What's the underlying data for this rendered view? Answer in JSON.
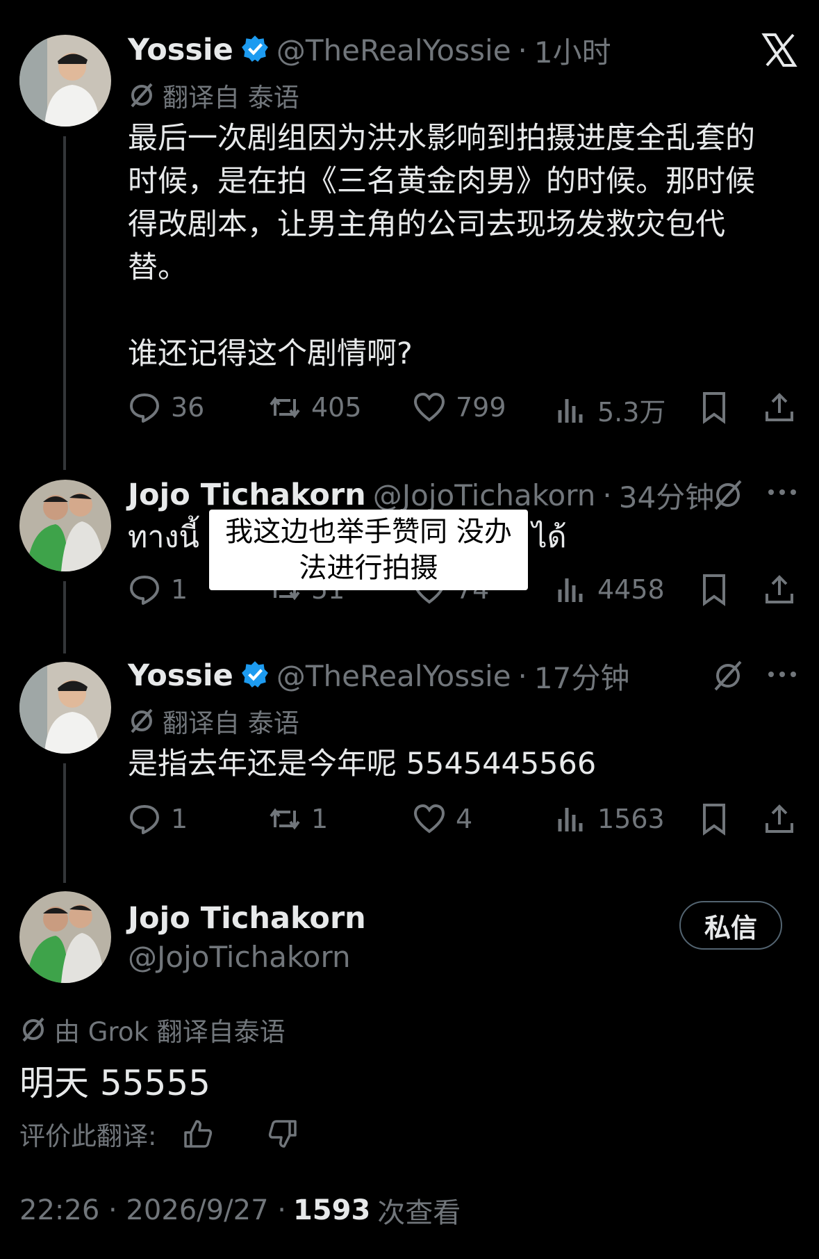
{
  "tweet1": {
    "name": "Yossie",
    "handle": "@TheRealYossie",
    "time": "1小时",
    "translated_label": "翻译自 泰语",
    "text_lines": [
      "最后一次剧组因为洪水影响到拍摄进度全乱套的",
      "时候，是在拍《三名黄金肉男》的时候。那时候",
      "得改剧本，让男主角的公司去现场发救灾包代",
      "替。"
    ],
    "text_line2": "谁还记得这个剧情啊?",
    "replies": "36",
    "reposts": "405",
    "likes": "799",
    "views": "5.3万"
  },
  "tweet2": {
    "name": "Jojo Tichakorn",
    "handle": "@JojoTichakorn",
    "time": "34分钟",
    "text_left": "ทางนี้",
    "text_right": "ได้",
    "overlay_line1": "我这边也举手赞同  没办",
    "overlay_line2": "法进行拍摄",
    "replies": "1",
    "reposts": "51",
    "likes": "74",
    "views": "4458"
  },
  "tweet3": {
    "name": "Yossie",
    "handle": "@TheRealYossie",
    "time": "17分钟",
    "translated_label": "翻译自 泰语",
    "text": "是指去年还是今年呢 5545445566",
    "replies": "1",
    "reposts": "1",
    "likes": "4",
    "views": "1563"
  },
  "focus": {
    "name": "Jojo Tichakorn",
    "handle": "@JojoTichakorn",
    "dm_label": "私信",
    "translated_label": "由 Grok 翻译自泰语",
    "text": "明天 55555",
    "rate_label": "评价此翻译:",
    "timestamp": "22:26 · 2026/9/27 ·",
    "views_count": "1593",
    "views_label": "次查看"
  },
  "colors": {
    "background": "#000000",
    "text": "#e7e9ea",
    "secondary": "#71767b",
    "verified": "#1d9bf0",
    "thread_line": "#333639"
  },
  "icons": [
    "close-x-icon",
    "translate-icon",
    "reply-icon",
    "repost-icon",
    "like-icon",
    "views-icon",
    "bookmark-icon",
    "share-icon",
    "more-icon",
    "verified-icon",
    "thumbs-up-icon",
    "thumbs-down-icon"
  ]
}
